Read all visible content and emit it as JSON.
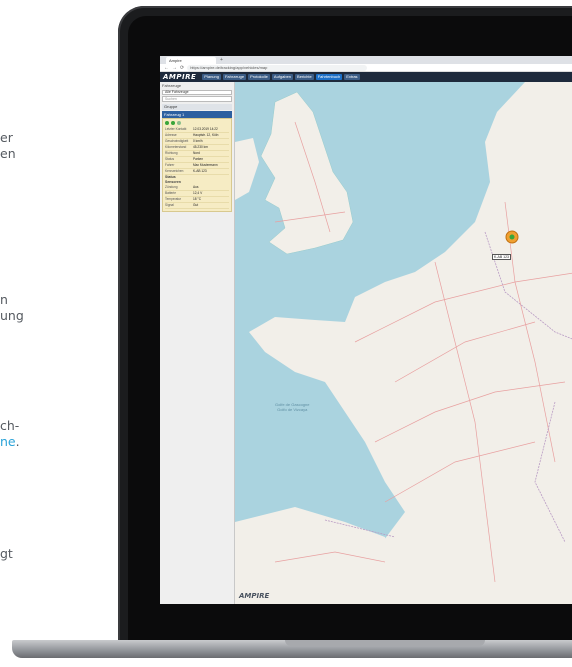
{
  "side_text": {
    "block1": [
      "er",
      "en"
    ],
    "block2": [
      "n",
      "ung"
    ],
    "block3_line1": "ch-",
    "block3_link": "ne",
    "block3_tail": ".",
    "block4": "gt"
  },
  "browser": {
    "tab_title": "Ampire",
    "new_tab": "+",
    "url": "https://ampire.de/tracking/app/vehicles/map"
  },
  "app": {
    "logo": "AMPIRE",
    "menu": [
      "Planung",
      "Fahrzeuge",
      "Protokolle",
      "Aufgaben",
      "Berichte",
      "Fahrtenbuch",
      "Extras"
    ],
    "active_menu_index": 5
  },
  "sidebar": {
    "label_fahrzeuge": "Fahrzeuge",
    "select_value": "Alle Fahrzeuge",
    "search_placeholder": "Suchen",
    "group": "Gruppe",
    "vehicle": "Fahrzeug 1",
    "detail_rows": [
      {
        "k": "Letzter Kontakt",
        "v": "12.03.2019 14:22"
      },
      {
        "k": "Adresse",
        "v": "Hauptstr. 12, Köln"
      },
      {
        "k": "Geschwindigkeit",
        "v": "0 km/h"
      },
      {
        "k": "Kilometerstand",
        "v": "45.230 km"
      },
      {
        "k": "Richtung",
        "v": "Nord"
      },
      {
        "k": "Status",
        "v": "Parken"
      },
      {
        "k": "Fahrer",
        "v": "Max Mustermann"
      },
      {
        "k": "Kennzeichen",
        "v": "K-AB 123"
      }
    ],
    "section_status": "Status",
    "section_sensors": "Sensoren",
    "bottom_rows": [
      {
        "k": "Zündung",
        "v": "Aus"
      },
      {
        "k": "Batterie",
        "v": "12,4 V"
      },
      {
        "k": "Temperatur",
        "v": "18 °C"
      },
      {
        "k": "Signal",
        "v": "Gut"
      }
    ]
  },
  "map": {
    "logo": "AMPIRE",
    "sea_label_line1": "Golfe de Gascogne",
    "sea_label_line2": "Golfo de Vizcaya",
    "marker_label": "K-AB 123",
    "colors": {
      "sea": "#aad3df",
      "land": "#f2efe9",
      "road": "#e8a0a0",
      "border": "#b99bc4"
    }
  }
}
